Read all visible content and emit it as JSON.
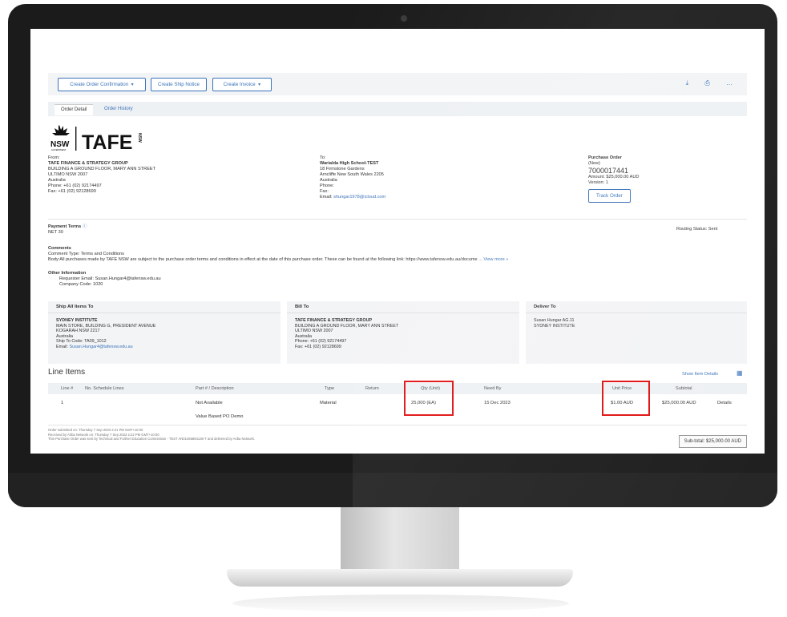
{
  "header": {
    "create_order_confirmation": "Create Order Confirmation",
    "create_ship_notice": "Create Ship Notice",
    "create_invoice": "Create Invoice",
    "icons": [
      "download-icon",
      "print-icon",
      "more-icon"
    ]
  },
  "tabs": [
    "Order Detail",
    "Order History"
  ],
  "logo": {
    "nsw": "NSW",
    "gov": "GOVERNMENT",
    "tafe": "TAFE",
    "nsw_vertical": "NSW"
  },
  "from": {
    "label": "From:",
    "name": "TAFE FINANCE & STRATEGY GROUP",
    "lines": [
      "BUILDING A GROUND FLOOR, MARY ANN STREET",
      "ULTIMO NSW 2007",
      "Australia",
      "Phone: +61 (02) 92174497",
      "Fax: +61 (02) 92128699"
    ]
  },
  "to": {
    "label": "To:",
    "name": "Warialda High School-TEST",
    "lines": [
      "18 Firmstone Gardens",
      "Arncliffe New South Wales 2205",
      "Australia",
      "Phone:",
      "Fax:"
    ],
    "email_label": "Email:",
    "email": "shungar1978@icloud.com"
  },
  "po": {
    "label": "Purchase Order",
    "status": "(New)",
    "number": "7000017441",
    "amount": "Amount: $25,000.00 AUD",
    "version": "Version: 1",
    "track": "Track Order"
  },
  "payment": {
    "label": "Payment Terms",
    "value": "NET 30",
    "routing": "Routing Status: Sent"
  },
  "comments": {
    "label": "Comments",
    "type": "Comment Type: Terms and Conditions",
    "body": "Body:All purchases made by TAFE NSW are subject to the purchase order terms and conditions in effect at the date of this purchase order. These can be found at the following link: https://www.tafensw.edu.au/docume",
    "view_more": "... View more »"
  },
  "other": {
    "label": "Other Information",
    "req_email": "Requester Email:  Susan.Hungar4@tafensw.edu.au",
    "company": "Company Code:  1020"
  },
  "ship_to": {
    "title": "Ship All Items To",
    "name": "SYDNEY INSTITUTE",
    "lines": [
      "MAIN STORE, BUILDING G, PRESIDENT AVENUE",
      "KOGARAH NSW 2217",
      "Australia",
      "Ship To Code:  TA09_1012"
    ],
    "email_label": "Email:",
    "email": "Susan.Hungar4@tafensw.edu.au"
  },
  "bill_to": {
    "title": "Bill To",
    "name": "TAFE FINANCE & STRATEGY GROUP",
    "lines": [
      "BUILDING A GROUND FLOOR, MARY ANN STREET",
      "ULTIMO NSW 2007",
      "Australia",
      "Phone: +61 (02) 92174497",
      "Fax: +61 (02) 92128699"
    ]
  },
  "deliver_to": {
    "title": "Deliver To",
    "lines": [
      "Susan Hungar AG.11",
      "SYDNEY INSTITUTE"
    ]
  },
  "line_items": {
    "title": "Line Items",
    "show_details": "Show Item Details",
    "columns": [
      "Line #",
      "No. Schedule Lines",
      "Part # / Description",
      "Type",
      "Return",
      "Qty (Unit)",
      "Need By",
      "Unit Price",
      "Subtotal"
    ],
    "rows": [
      {
        "line": "1",
        "part": "Not Available",
        "desc": "Value Based PO Demo",
        "type": "Material",
        "qty": "25,000 (EA)",
        "need_by": "15 Dec 2023",
        "unit_price": "$1.00 AUD",
        "subtotal": "$25,000.00 AUD",
        "details": "Details"
      }
    ]
  },
  "footer": {
    "lines": [
      "Order submitted on: Thursday 7 Sep 2023 2:21 PM GMT+10:00",
      "Received by Ariba Network on: Thursday 7 Sep 2023 2:22 PM GMT+10:00",
      "This Purchase Order was sent by Technical and Further Education Commission - TEST AN01465884136-T and delivered by Ariba Network."
    ],
    "subtotal": "Sub-total: $25,000.00 AUD"
  },
  "colors": {
    "accent": "#3b73b9",
    "highlight": "#e01010",
    "panel": "#f3f4f6"
  }
}
